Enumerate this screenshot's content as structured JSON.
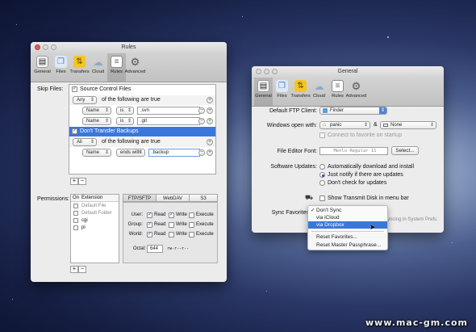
{
  "watermark": "www.mac-gm.com",
  "rules_window": {
    "title": "Rules",
    "toolbar": [
      {
        "label": "General",
        "icon": "switch-icon"
      },
      {
        "label": "Files",
        "icon": "files-icon"
      },
      {
        "label": "Transfers",
        "icon": "transfers-icon"
      },
      {
        "label": "Cloud",
        "icon": "cloud-icon"
      },
      {
        "label": "Rules",
        "icon": "rules-icon"
      },
      {
        "label": "Advanced",
        "icon": "gear-icon"
      }
    ],
    "skip_files_label": "Skip Files:",
    "skip_files": {
      "group1_checkbox": "Source Control Files",
      "group1_match": "Any",
      "group1_suffix": "of the following are true",
      "rule1": {
        "field": "Name",
        "op": "is",
        "value": ".svn"
      },
      "rule2": {
        "field": "Name",
        "op": "is",
        "value": ".git"
      },
      "group2_checkbox": "Don't Transfer Backups",
      "group2_match": "All",
      "group2_suffix": "of the following are true",
      "rule3": {
        "field": "Name",
        "op": "ends with",
        "value": ".backup"
      },
      "add": "+",
      "remove": "−"
    },
    "permissions_label": "Permissions:",
    "permissions": {
      "col_on": "On",
      "col_extension": "Extension",
      "items": [
        "Default File",
        "Default Folder",
        "cgi",
        "pl"
      ],
      "tabs": [
        "FTP/SFTP",
        "WebDAV",
        "S3"
      ],
      "matrix_rows": [
        "User:",
        "Group:",
        "World:"
      ],
      "matrix_cols": [
        "Read",
        "Write",
        "Execute"
      ],
      "octal_label": "Octal:",
      "octal_value": "644",
      "octal_symbolic": "rw-r--r--",
      "add": "+",
      "remove": "−"
    }
  },
  "general_window": {
    "title": "General",
    "toolbar": [
      {
        "label": "General",
        "icon": "switch-icon"
      },
      {
        "label": "Files",
        "icon": "files-icon"
      },
      {
        "label": "Transfers",
        "icon": "transfers-icon"
      },
      {
        "label": "Cloud",
        "icon": "cloud-icon"
      },
      {
        "label": "Rules",
        "icon": "rules-icon"
      },
      {
        "label": "Advanced",
        "icon": "gear-icon"
      }
    ],
    "ftp_client_label": "Default FTP Client:",
    "ftp_client_value": "Finder",
    "windows_open_label": "Windows open with:",
    "windows_open_value": "panic",
    "windows_open_and": "&",
    "windows_open_second": "None",
    "favorite_startup": "Connect to favorite on startup",
    "editor_font_label": "File Editor Font:",
    "editor_font_value": "Menlo Regular 11",
    "select_button": "Select...",
    "updates_label": "Software Updates:",
    "updates_options": [
      "Automatically download and install",
      "Just notify if there are updates",
      "Don't check for updates"
    ],
    "show_disk": "Show Transmit Disk in menu bar",
    "sync_label": "Sync Favorites",
    "sync_hint": "yncing in System Prefs.",
    "sync_menu": {
      "items": [
        "Don't Sync",
        "via iCloud",
        "via Dropbox"
      ],
      "actions": [
        "Reset Favorites...",
        "Reset Master Passphrase..."
      ]
    }
  }
}
